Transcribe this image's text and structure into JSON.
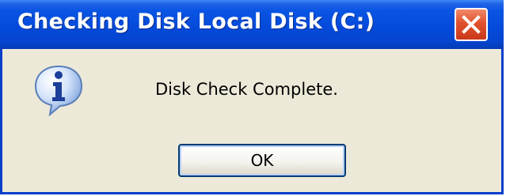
{
  "window": {
    "title": "Checking Disk Local Disk (C:)",
    "close_icon": "close-icon"
  },
  "dialog": {
    "icon": "info-icon",
    "message": "Disk Check Complete.",
    "ok_label": "OK"
  },
  "colors": {
    "titlebar": "#0449D9",
    "frame": "#0A3FCB",
    "client_background": "#ECE9D8",
    "close_button": "#E2512D"
  }
}
